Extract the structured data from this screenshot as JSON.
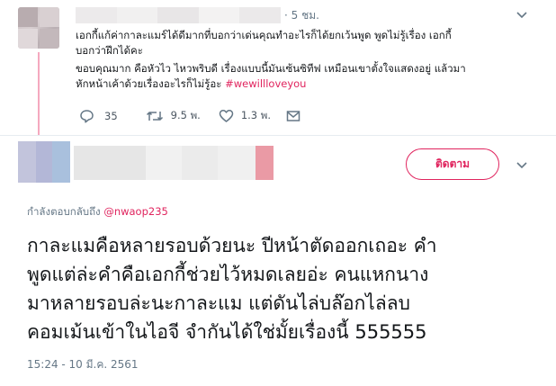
{
  "parent_tweet": {
    "time": "· 5 ชม.",
    "text_line1": "เอกกี้แก้ค่ากาละแมร์ได้ดีมากที่บอกว่าเด่นคุณทำอะไรก็ได้ยกเว้นพูด พูดไม่รู้เรื่อง เอกกี้",
    "text_line2": "บอกว่าฝึกได้คะ",
    "text_line3": "ขอบคุณมาก คือหัวไว ไหวพริบดี เรื่องแบบนี้มันเซ้นซิทีฟ เหมือนเขาตั้งใจแสดงอยู่ แล้วมา",
    "text_line4_prefix": "หักหน้าเค้าด้วยเรื่องอะไรก็ไม่รู้อะ",
    "hashtag": "#wewillloveyou",
    "reply_count": "35",
    "retweet_count": "9.5 พ.",
    "like_count": "1.3 พ.",
    "colors": {
      "thread_line": "#f5a9bf",
      "hashtag": "#e0245e"
    }
  },
  "main_tweet": {
    "follow_label": "ติดตาม",
    "reply_prefix": "กำลังตอบกลับถึง",
    "reply_handle": "@nwaop235",
    "text_lines": [
      "กาละแมคือหลายรอบด้วยนะ ปีหน้าตัดออกเถอะ คำ",
      "พูดแต่ล่ะคำคือเอกกี้ช่วยไว้หมดเลยอ่ะ คนแหกนาง",
      "มาหลายรอบล่ะนะกาละแม แต่ดันไล่บล๊อกไล่ลบ",
      "คอมเม้นเข้าในไอจี จำกันได้ใช่มั้ยเรื่องนี้ 555555"
    ],
    "timestamp": "15:24 - 10 มี.ค. 2561",
    "colors": {
      "accent": "#e0245e"
    }
  },
  "icons": {
    "reply": "reply-icon",
    "retweet": "retweet-icon",
    "like": "heart-icon",
    "dm": "envelope-icon",
    "more": "chevron-down-icon"
  }
}
